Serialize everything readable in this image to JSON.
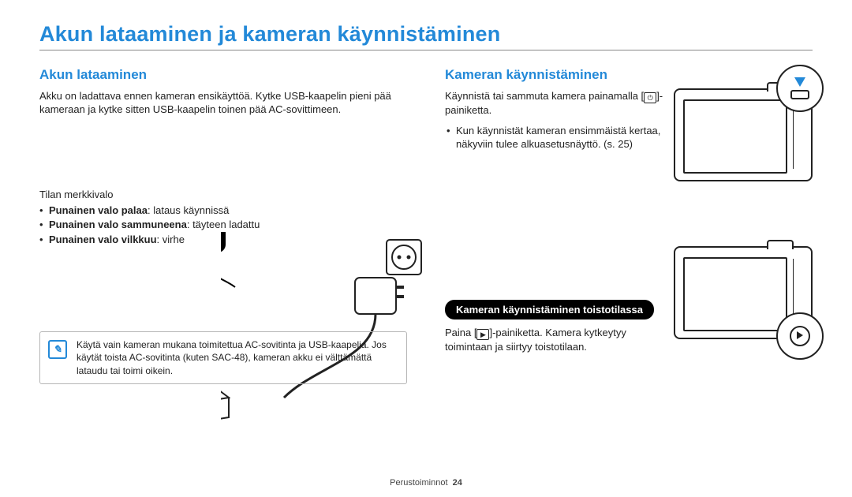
{
  "page_title": "Akun lataaminen ja kameran käynnistäminen",
  "left": {
    "heading": "Akun lataaminen",
    "intro": "Akku on ladattava ennen kameran ensikäyttöä. Kytke USB-kaapelin pieni pää kameraan ja kytke sitten USB-kaapelin toinen pää AC-sovittimeen.",
    "status_label": "Tilan merkkivalo",
    "s1_bold": "Punainen valo palaa",
    "s1_tail": ": lataus käynnissä",
    "s2_bold": "Punainen valo sammuneena",
    "s2_tail": ": täyteen ladattu",
    "s3_bold": "Punainen valo vilkkuu",
    "s3_tail": ": virhe",
    "note": "Käytä vain kameran mukana toimitettua AC-sovitinta ja USB-kaapelia. Jos käytät toista AC-sovitinta (kuten SAC-48), kameran akku ei välttämättä lataudu tai toimi oikein."
  },
  "right": {
    "heading": "Kameran käynnistäminen",
    "p1a": "Käynnistä tai sammuta kamera painamalla [",
    "p1b": "]-painiketta.",
    "bullet": "Kun käynnistät kameran ensimmäistä kertaa, näkyviin tulee alkuasetusnäyttö. (s. 25)",
    "pill": "Kameran käynnistäminen toistotilassa",
    "p2a": "Paina [",
    "p2b": "]-painiketta. Kamera kytkeytyy toimintaan ja siirtyy toistotilaan."
  },
  "footer_label": "Perustoiminnot",
  "footer_page": "24",
  "icons": {
    "power": "⏻",
    "play": "▶"
  }
}
